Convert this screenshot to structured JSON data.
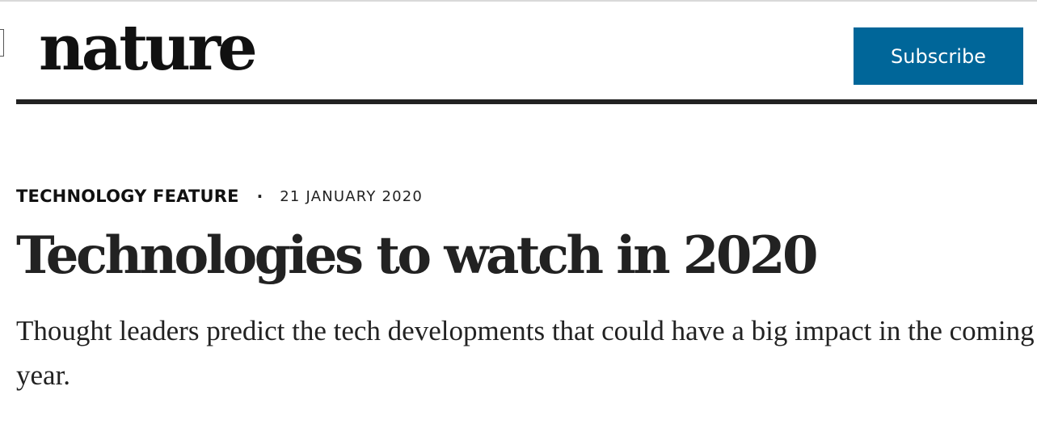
{
  "header": {
    "logo_text": "nature",
    "subscribe_label": "Subscribe",
    "accent_color": "#006699"
  },
  "article": {
    "type": "TECHNOLOGY FEATURE",
    "separator": "·",
    "date": "21 JANUARY 2020",
    "title": "Technologies to watch in 2020",
    "standfirst": "Thought leaders predict the tech developments that could have a big impact in the coming year."
  }
}
